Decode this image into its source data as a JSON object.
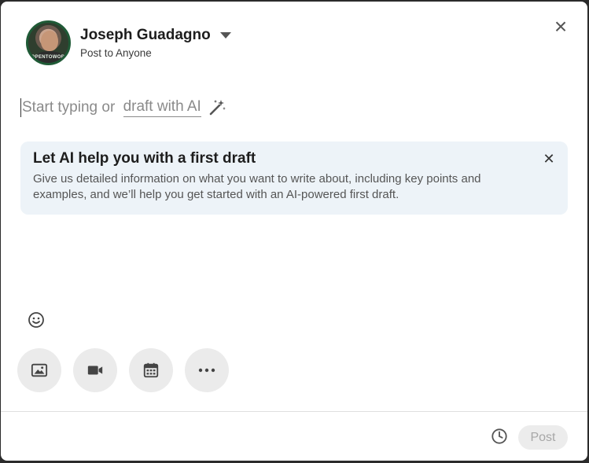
{
  "header": {
    "user_name": "Joseph Guadagno",
    "visibility": "Post to Anyone",
    "avatar_badge": "#OPENTOWORK"
  },
  "editor": {
    "placeholder_prefix": "Start typing or ",
    "draft_link": "draft with AI"
  },
  "ai_card": {
    "title": "Let AI help you with a first draft",
    "description": "Give us detailed information on what you want to write about, including key points and examples, and we’ll help you get started with an AI-powered first draft."
  },
  "toolbar": {
    "emoji_icon": "emoji-smile-icon",
    "tools": [
      {
        "name": "add-media-button",
        "icon": "image-icon"
      },
      {
        "name": "add-video-button",
        "icon": "video-camera-icon"
      },
      {
        "name": "add-event-button",
        "icon": "calendar-icon"
      },
      {
        "name": "more-options-button",
        "icon": "ellipsis-icon"
      }
    ]
  },
  "footer": {
    "schedule_icon": "clock-icon",
    "post_label": "Post"
  },
  "colors": {
    "ai_card_bg": "#edf3f8",
    "tool_bg": "#ebebeb",
    "post_disabled_bg": "#ececec",
    "post_disabled_text": "#a7a7a7"
  }
}
